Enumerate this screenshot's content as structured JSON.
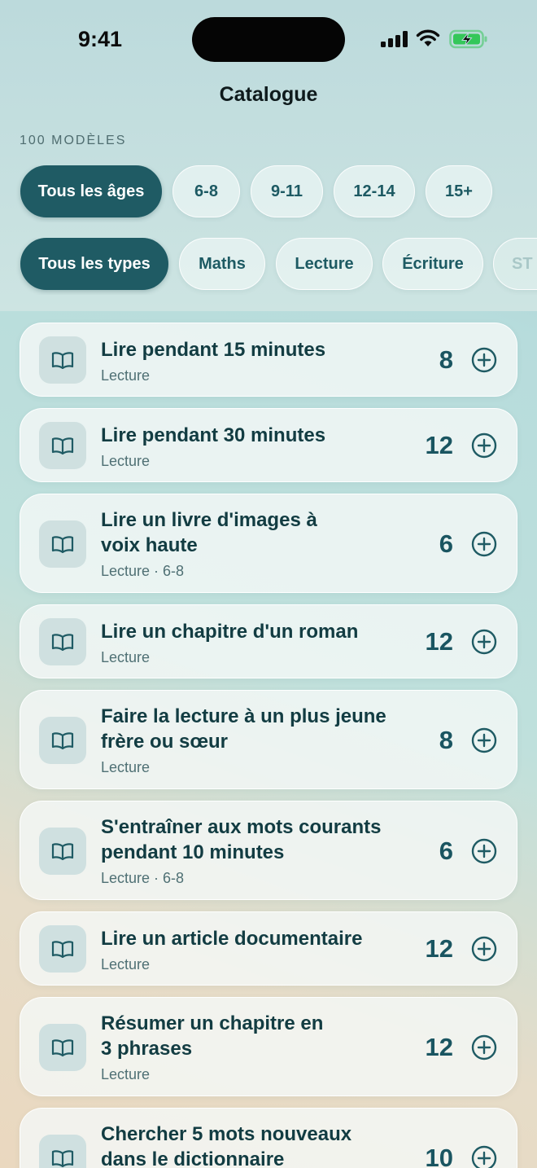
{
  "status": {
    "time": "9:41"
  },
  "page": {
    "title": "Catalogue",
    "count": "100 MODÈLES"
  },
  "age_filters": [
    "Tous les âges",
    "6-8",
    "9-11",
    "12-14",
    "15+"
  ],
  "type_filters": [
    "Tous les types",
    "Maths",
    "Lecture",
    "Écriture",
    "ST"
  ],
  "colors": {
    "accent": "#1f5b64",
    "chip_bg": "#ecf6f5",
    "card_bg": "#f4f8f7",
    "icon_bg": "#cfe0e0"
  },
  "icons": {
    "item": "book-open-icon",
    "add": "plus-circle-icon"
  },
  "items": [
    {
      "title": "Lire pendant 15 minutes",
      "subtitle": "Lecture",
      "points": "8"
    },
    {
      "title": "Lire pendant 30 minutes",
      "subtitle": "Lecture",
      "points": "12"
    },
    {
      "title": "Lire un livre d'images à voix haute",
      "subtitle": "Lecture · 6-8",
      "points": "6"
    },
    {
      "title": "Lire un chapitre d'un roman",
      "subtitle": "Lecture",
      "points": "12"
    },
    {
      "title": "Faire la lecture à un plus jeune frère ou sœur",
      "subtitle": "Lecture",
      "points": "8"
    },
    {
      "title": "S'entraîner aux mots courants pendant 10 minutes",
      "subtitle": "Lecture · 6-8",
      "points": "6"
    },
    {
      "title": "Lire un article documentaire",
      "subtitle": "Lecture",
      "points": "12"
    },
    {
      "title": "Résumer un chapitre en 3 phrases",
      "subtitle": "Lecture",
      "points": "12"
    },
    {
      "title": "Chercher 5 mots nouveaux dans le dictionnaire",
      "subtitle": "",
      "points": "10"
    }
  ]
}
